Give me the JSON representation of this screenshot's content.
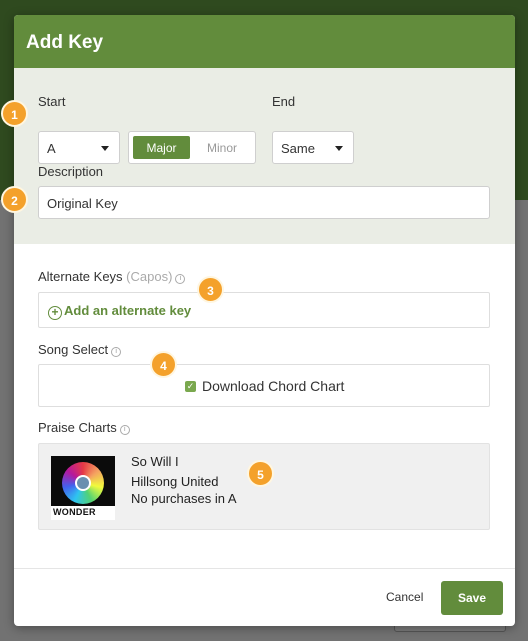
{
  "modal": {
    "title": "Add Key",
    "start": {
      "label": "Start",
      "value": "A"
    },
    "mode": {
      "major": "Major",
      "minor": "Minor",
      "selected": "Major"
    },
    "end": {
      "label": "End",
      "value": "Same"
    },
    "description": {
      "label": "Description",
      "value": "Original Key"
    },
    "alternate_keys": {
      "label": "Alternate Keys",
      "sub_label": "(Capos)",
      "add_link": "Add an alternate key"
    },
    "song_select": {
      "label": "Song Select",
      "checkbox_label": "Download Chord Chart",
      "checked": true
    },
    "praise_charts": {
      "label": "Praise Charts",
      "album_text": "WONDER",
      "song_title": "So Will I",
      "artist": "Hillsong United",
      "purchase_status": "No purchases in A"
    },
    "footer": {
      "cancel": "Cancel",
      "save": "Save"
    }
  },
  "annotations": [
    "1",
    "2",
    "3",
    "4",
    "5"
  ],
  "colors": {
    "accent": "#628c3c",
    "badge": "#f4a12b",
    "top_section_bg": "#eaede5"
  }
}
